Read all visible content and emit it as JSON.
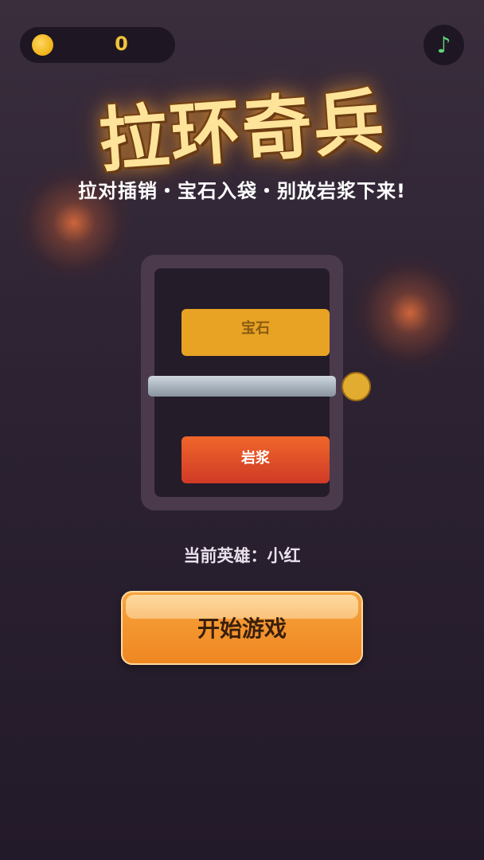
{
  "hud": {
    "coin_icon": "gold-coin-icon",
    "coins": "0",
    "music_icon": "music-note-icon",
    "music_glyph": "♪"
  },
  "title": {
    "main": "拉环奇兵",
    "subtitle": "拉对插销・宝石入袋・别放岩浆下来!"
  },
  "preview": {
    "gem_label": "宝石",
    "lava_label": "岩浆"
  },
  "hero": {
    "line": "当前英雄：小红"
  },
  "start_button": {
    "label": "开始游戏"
  },
  "colors": {
    "background": "#2c2232",
    "coin": "#f3c33a",
    "gem": "#e8a325",
    "lava": "#e04e28",
    "pin": "#a7b1bc",
    "music_note": "#5fd67a",
    "start_button": "#f29a32"
  }
}
